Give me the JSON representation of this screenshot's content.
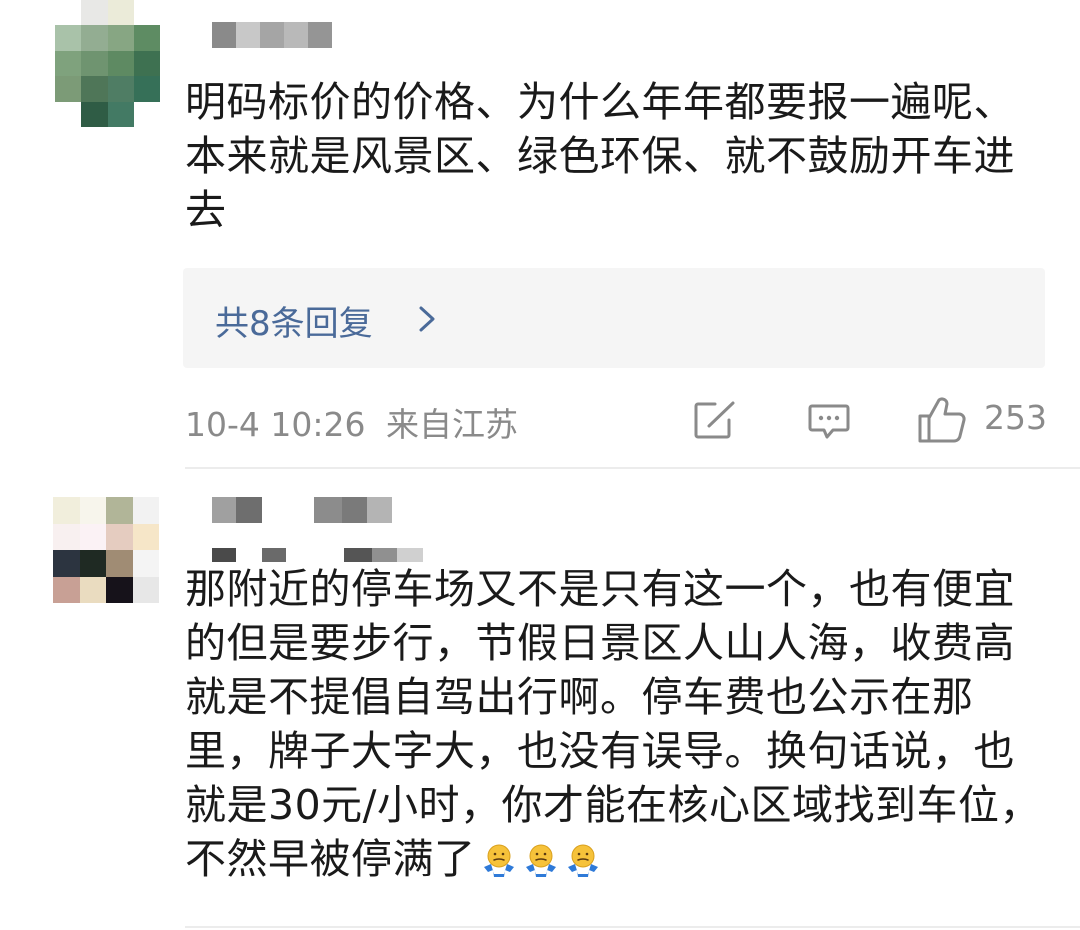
{
  "comments": [
    {
      "text": "明码标价的价格、为什么年年都要报一遍呢、本来就是风景区、绿色环保、就不鼓励开车进去",
      "replies_label": "共8条回复",
      "date": "10-4 10:26",
      "location": "来自江苏",
      "likes": "253"
    },
    {
      "text": "那附近的停车场又不是只有这一个，也有便宜的但是要步行，节假日景区人山人海，收费高就是不提倡自驾出行啊。停车费也公示在那里，牌子大字大，也没有误导。换句话说，也就是30元/小时，你才能在核心区域找到车位，不然早被停满了",
      "emoji_count": 3,
      "emoji_icon": "shrug-emoji-icon"
    }
  ],
  "icons": {
    "edit": "edit-share-icon",
    "comment": "comment-icon",
    "like": "thumbs-up-icon",
    "chevron": "chevron-right-icon"
  },
  "colors": {
    "link": "#4a6a99",
    "meta": "#8a8a8a",
    "reply_bg": "#f5f5f5",
    "text": "#1a1a1a"
  }
}
